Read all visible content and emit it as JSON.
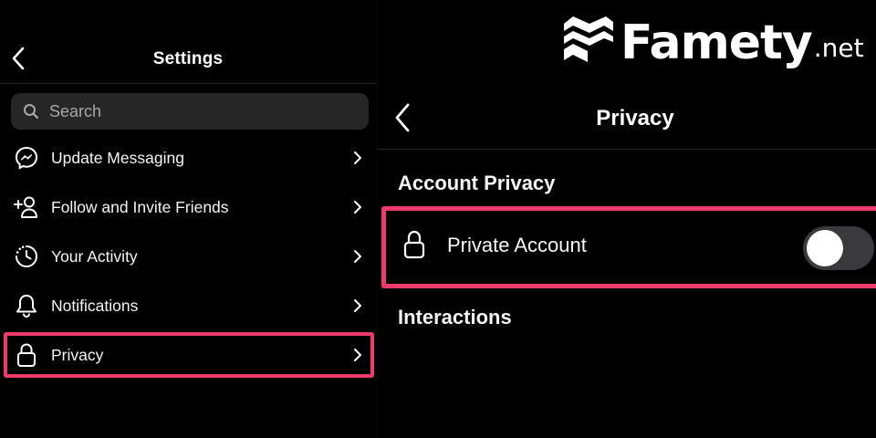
{
  "settings": {
    "title": "Settings",
    "back_icon": "chevron-left-icon",
    "search": {
      "placeholder": "Search",
      "value": ""
    },
    "items": [
      {
        "label": "Update Messaging",
        "icon": "messenger-icon"
      },
      {
        "label": "Follow and Invite Friends",
        "icon": "add-person-icon"
      },
      {
        "label": "Your Activity",
        "icon": "activity-clock-icon"
      },
      {
        "label": "Notifications",
        "icon": "bell-icon"
      },
      {
        "label": "Privacy",
        "icon": "lock-icon",
        "highlighted": true
      }
    ]
  },
  "privacy": {
    "title": "Privacy",
    "back_icon": "chevron-left-icon",
    "section_account": "Account Privacy",
    "private_account": {
      "label": "Private Account",
      "enabled": false
    },
    "section_interactions": "Interactions"
  },
  "brand": {
    "name": "Famety",
    "tld": ".net"
  },
  "colors": {
    "highlight": "#ef3a6d",
    "background": "#000000",
    "search_bg": "#262626",
    "toggle_off": "#3a3a3c"
  }
}
